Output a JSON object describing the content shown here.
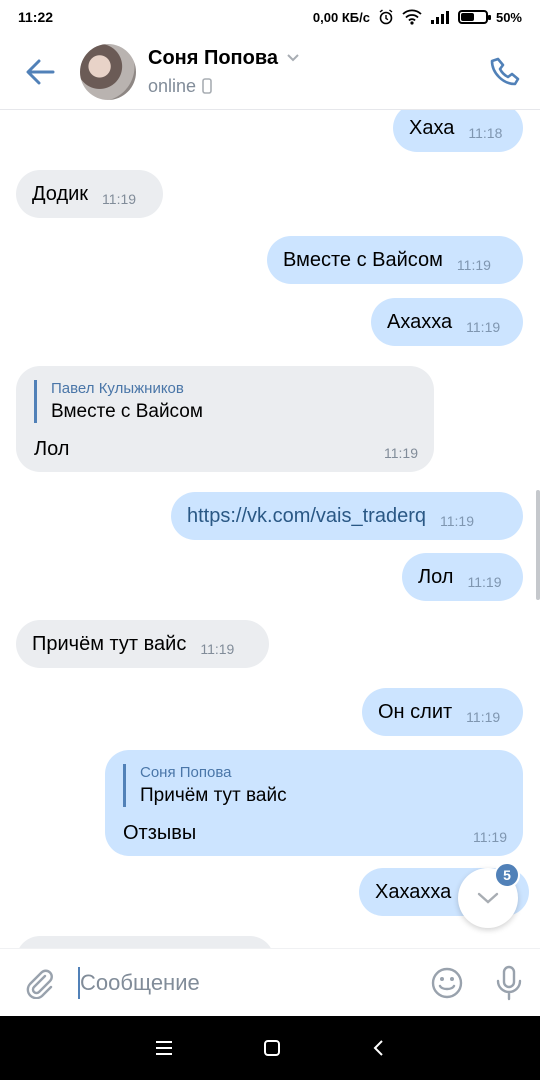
{
  "status_bar": {
    "time": "11:22",
    "network_speed": "0,00 КБ/с",
    "battery_percent": "50%",
    "battery_level": 0.5
  },
  "header": {
    "back_icon": "arrow-left-icon",
    "contact_name": "Соня Попова",
    "status": "online",
    "call_icon": "phone-icon"
  },
  "messages": [
    {
      "direction": "out",
      "text": "Хаха",
      "time": "11:18"
    },
    {
      "direction": "in",
      "text": "Додик",
      "time": "11:19"
    },
    {
      "direction": "out",
      "text": "Вместе с Вайсом",
      "time": "11:19"
    },
    {
      "direction": "out",
      "text": "Ахахха",
      "time": "11:19"
    },
    {
      "direction": "in",
      "reply_author": "Павел Кулыжников",
      "reply_text": "Вместе с Вайсом",
      "text": "Лол",
      "time": "11:19"
    },
    {
      "direction": "out",
      "text": "https://vk.com/vais_traderq",
      "time": "11:19"
    },
    {
      "direction": "out",
      "text": "Лол",
      "time": "11:19"
    },
    {
      "direction": "in",
      "text": "Причём тут вайс",
      "time": "11:19"
    },
    {
      "direction": "out",
      "text": "Он слит",
      "time": "11:19"
    },
    {
      "direction": "out",
      "reply_author": "Соня Попова",
      "reply_text": "Причём тут вайс",
      "text": "Отзывы",
      "time": "11:19"
    },
    {
      "direction": "out",
      "text": "Хахахха"
    }
  ],
  "scroll_down_badge": "5",
  "composer": {
    "placeholder": "Сообщение"
  },
  "colors": {
    "accent": "#5181b8",
    "incoming_bubble": "#ebedf0",
    "outgoing_bubble": "#cce4ff"
  }
}
